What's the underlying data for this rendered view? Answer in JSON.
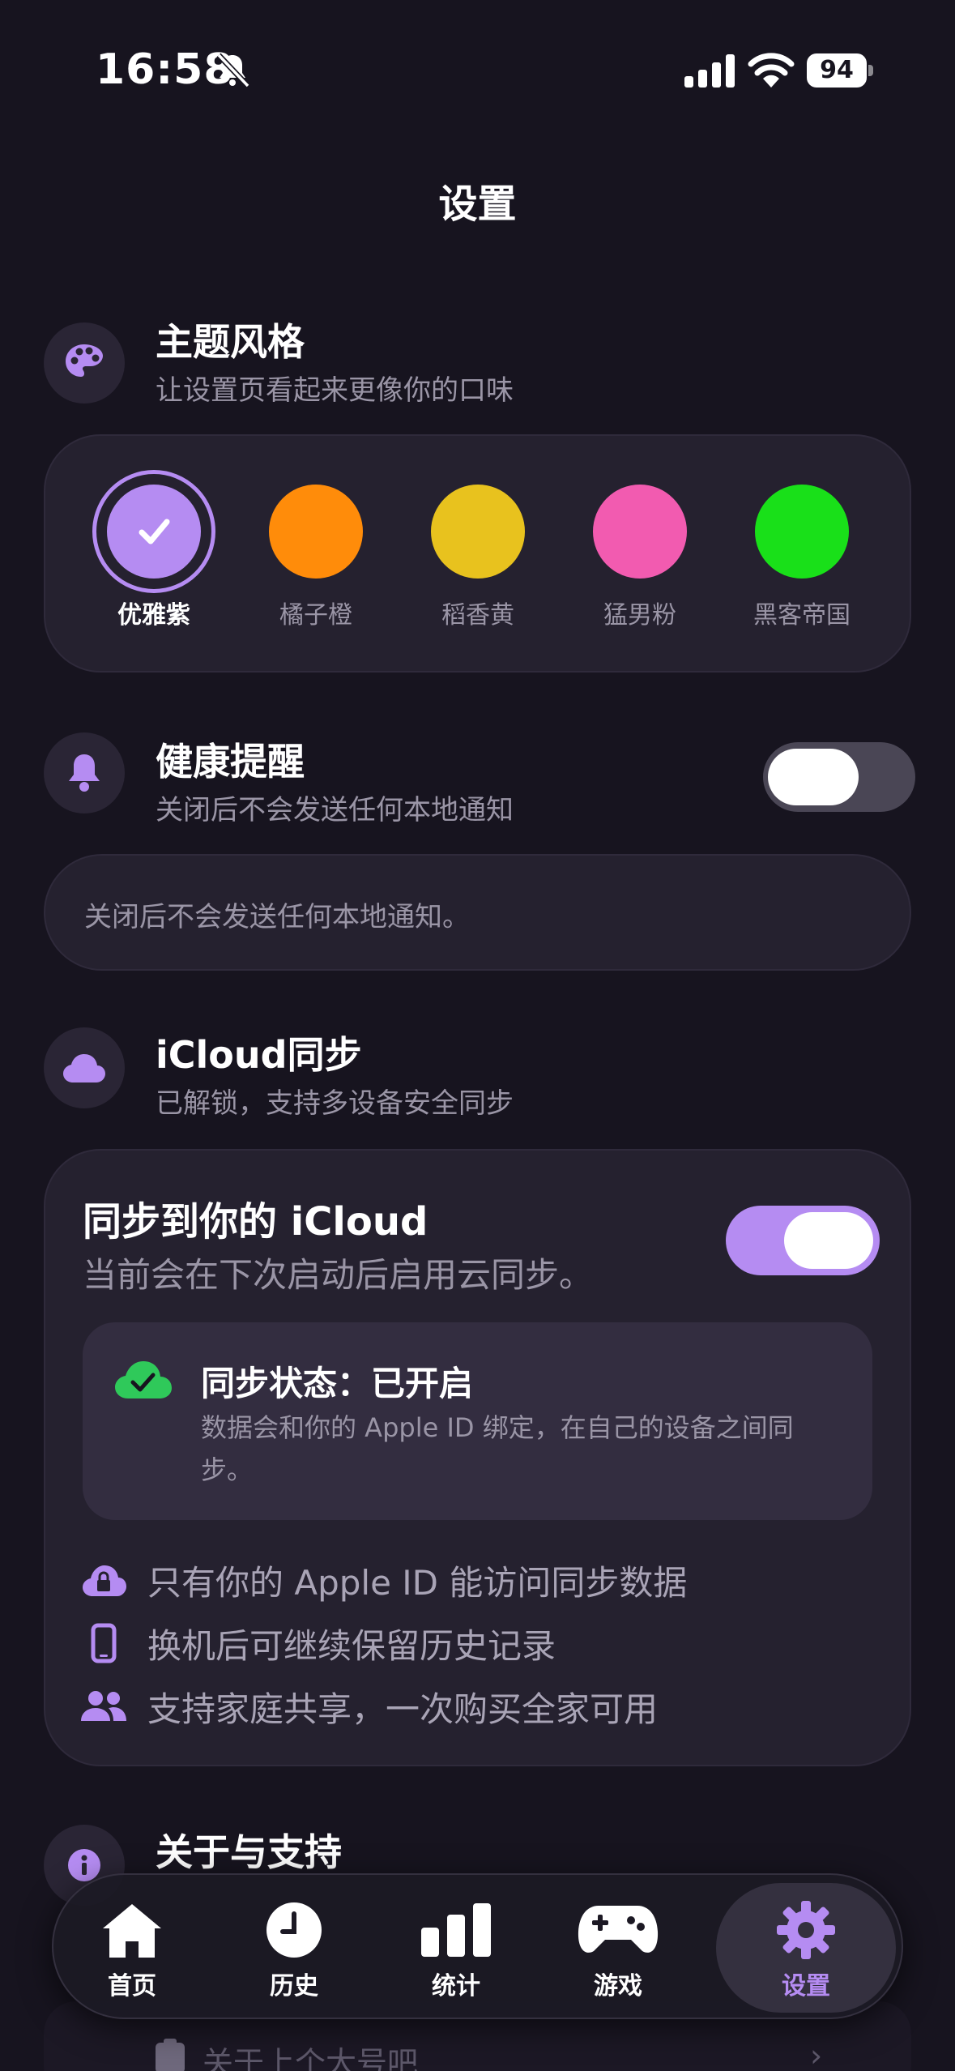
{
  "status_bar": {
    "time": "16:58",
    "battery": "94"
  },
  "page": {
    "title": "设置"
  },
  "theme": {
    "title": "主题风格",
    "subtitle": "让设置页看起来更像你的口味",
    "options": [
      {
        "label": "优雅紫",
        "color": "#b58cf2",
        "selected": true
      },
      {
        "label": "橘子橙",
        "color": "#ff8c0a",
        "selected": false
      },
      {
        "label": "稻香黄",
        "color": "#e8c21e",
        "selected": false
      },
      {
        "label": "猛男粉",
        "color": "#f25bb0",
        "selected": false
      },
      {
        "label": "黑客帝国",
        "color": "#19e019",
        "selected": false
      }
    ]
  },
  "health": {
    "title": "健康提醒",
    "subtitle": "关闭后不会发送任何本地通知",
    "toggle_on": false,
    "note": "关闭后不会发送任何本地通知。"
  },
  "icloud": {
    "title": "iCloud同步",
    "subtitle": "已解锁，支持多设备安全同步",
    "card_title": "同步到你的 iCloud",
    "card_subtitle": "当前会在下次启动后启用云同步。",
    "toggle_on": true,
    "status_title": "同步状态：已开启",
    "status_desc": "数据会和你的 Apple ID 绑定，在自己的设备之间同步。",
    "features": [
      {
        "icon": "lock-cloud-icon",
        "text": "只有你的 Apple ID 能访问同步数据"
      },
      {
        "icon": "phone-icon",
        "text": "换机后可继续保留历史记录"
      },
      {
        "icon": "family-icon",
        "text": "支持家庭共享，一次购买全家可用"
      }
    ]
  },
  "about": {
    "title": "关于与支持",
    "peek_item": "关于上个大号吧"
  },
  "tabs": [
    {
      "label": "首页",
      "icon": "home-icon",
      "active": false
    },
    {
      "label": "历史",
      "icon": "clock-icon",
      "active": false
    },
    {
      "label": "统计",
      "icon": "bar-chart-icon",
      "active": false
    },
    {
      "label": "游戏",
      "icon": "gamepad-icon",
      "active": false
    },
    {
      "label": "设置",
      "icon": "gear-icon",
      "active": true
    }
  ],
  "colors": {
    "background": "#17141f",
    "card": "#25212f",
    "accent": "#b58cf2",
    "muted_text": "#9a95a6",
    "success": "#2fc95a"
  }
}
